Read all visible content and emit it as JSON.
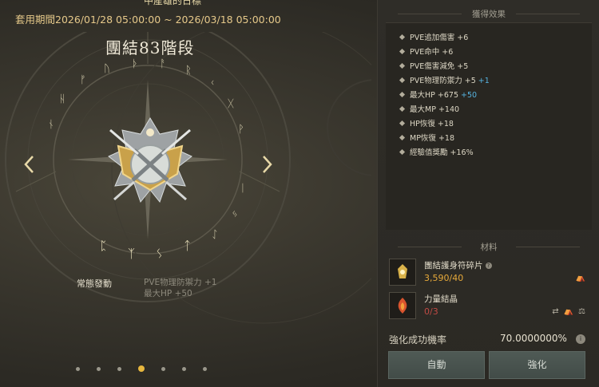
{
  "header": {
    "top_clipped_text": "中産雄的日標",
    "period": "套用期間2026/01/28 05:00:00 ~ 2026/03/18 05:00:00"
  },
  "stage": {
    "title": "團結83階段"
  },
  "passive": {
    "label": "常態發動",
    "effect_line1": "PVE物理防禦力 +1",
    "effect_line2": "最大HP +50"
  },
  "pagination": {
    "total": 7,
    "active_index": 3
  },
  "effects": {
    "title": "獲得效果",
    "items": [
      {
        "text": "PVE追加傷害 +6",
        "extra": ""
      },
      {
        "text": "PVE命中 +6",
        "extra": ""
      },
      {
        "text": "PVE傷害減免 +5",
        "extra": ""
      },
      {
        "text": "PVE物理防禦力 +5",
        "extra": "+1"
      },
      {
        "text": "最大HP +675",
        "extra": "+50"
      },
      {
        "text": "最大MP +140",
        "extra": ""
      },
      {
        "text": "HP恢復 +18",
        "extra": ""
      },
      {
        "text": "MP恢復 +18",
        "extra": ""
      },
      {
        "text": "經驗值獎勵 +16%",
        "extra": ""
      }
    ]
  },
  "materials": {
    "title": "材料",
    "items": [
      {
        "name": "團結護身符碎片",
        "count": "3,590/40",
        "status": "ok"
      },
      {
        "name": "力量結晶",
        "count": "0/3",
        "status": "bad"
      }
    ]
  },
  "success_rate": {
    "label": "強化成功機率",
    "value": "70.0000000%"
  },
  "buttons": {
    "auto": "自動",
    "enhance": "強化"
  },
  "colors": {
    "gold_accent": "#e7b73e",
    "extra_blue": "#56b3e0",
    "deficit_red": "#c04a44",
    "button_bg": "#4a5550"
  }
}
